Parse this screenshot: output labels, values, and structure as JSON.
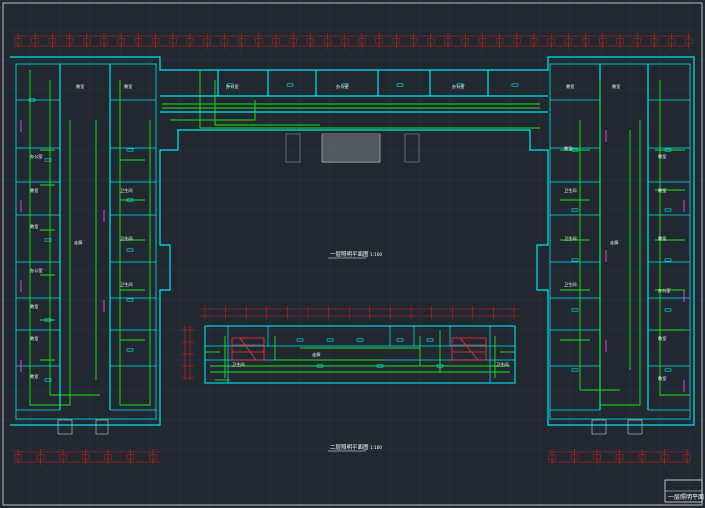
{
  "colors": {
    "background": "#212830",
    "wall": "#00e5f0",
    "wire": "#19e619",
    "axis": "#e02020",
    "text": "#ffffff",
    "device": "#ff3030",
    "frame": "#e6e6e6",
    "door": "#e040e0",
    "grid": "#2a3b58"
  },
  "drawing": {
    "upper_plan_title": "一层照明平面图",
    "lower_plan_title": "二层照明平面图",
    "scale_note": "1:100",
    "title_block_text": "一层照明平面"
  },
  "rooms": {
    "classroom": "教室",
    "office": "办公室",
    "toilet": "卫生间",
    "corridor": "走廊"
  }
}
